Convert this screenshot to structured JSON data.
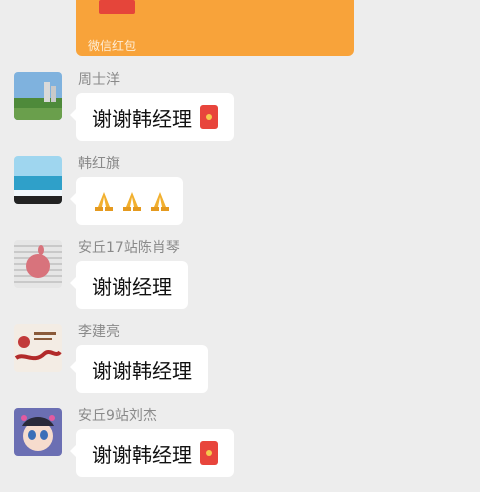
{
  "red_packet": {
    "label": "微信红包"
  },
  "messages": [
    {
      "sender": "周士洋",
      "text": "谢谢韩经理",
      "emoji": "red-envelope"
    },
    {
      "sender": "韩红旗",
      "text": "",
      "emoji": "praying-hands-x3"
    },
    {
      "sender": "安丘17站陈肖琴",
      "text": "谢谢经理",
      "emoji": ""
    },
    {
      "sender": "李建亮",
      "text": "谢谢韩经理",
      "emoji": ""
    },
    {
      "sender": "安丘9站刘杰",
      "text": "谢谢韩经理",
      "emoji": "red-envelope"
    }
  ],
  "colors": {
    "background": "#ededed",
    "bubble": "#ffffff",
    "red_packet": "#f8a33a",
    "sender_text": "#8a8a8a"
  }
}
